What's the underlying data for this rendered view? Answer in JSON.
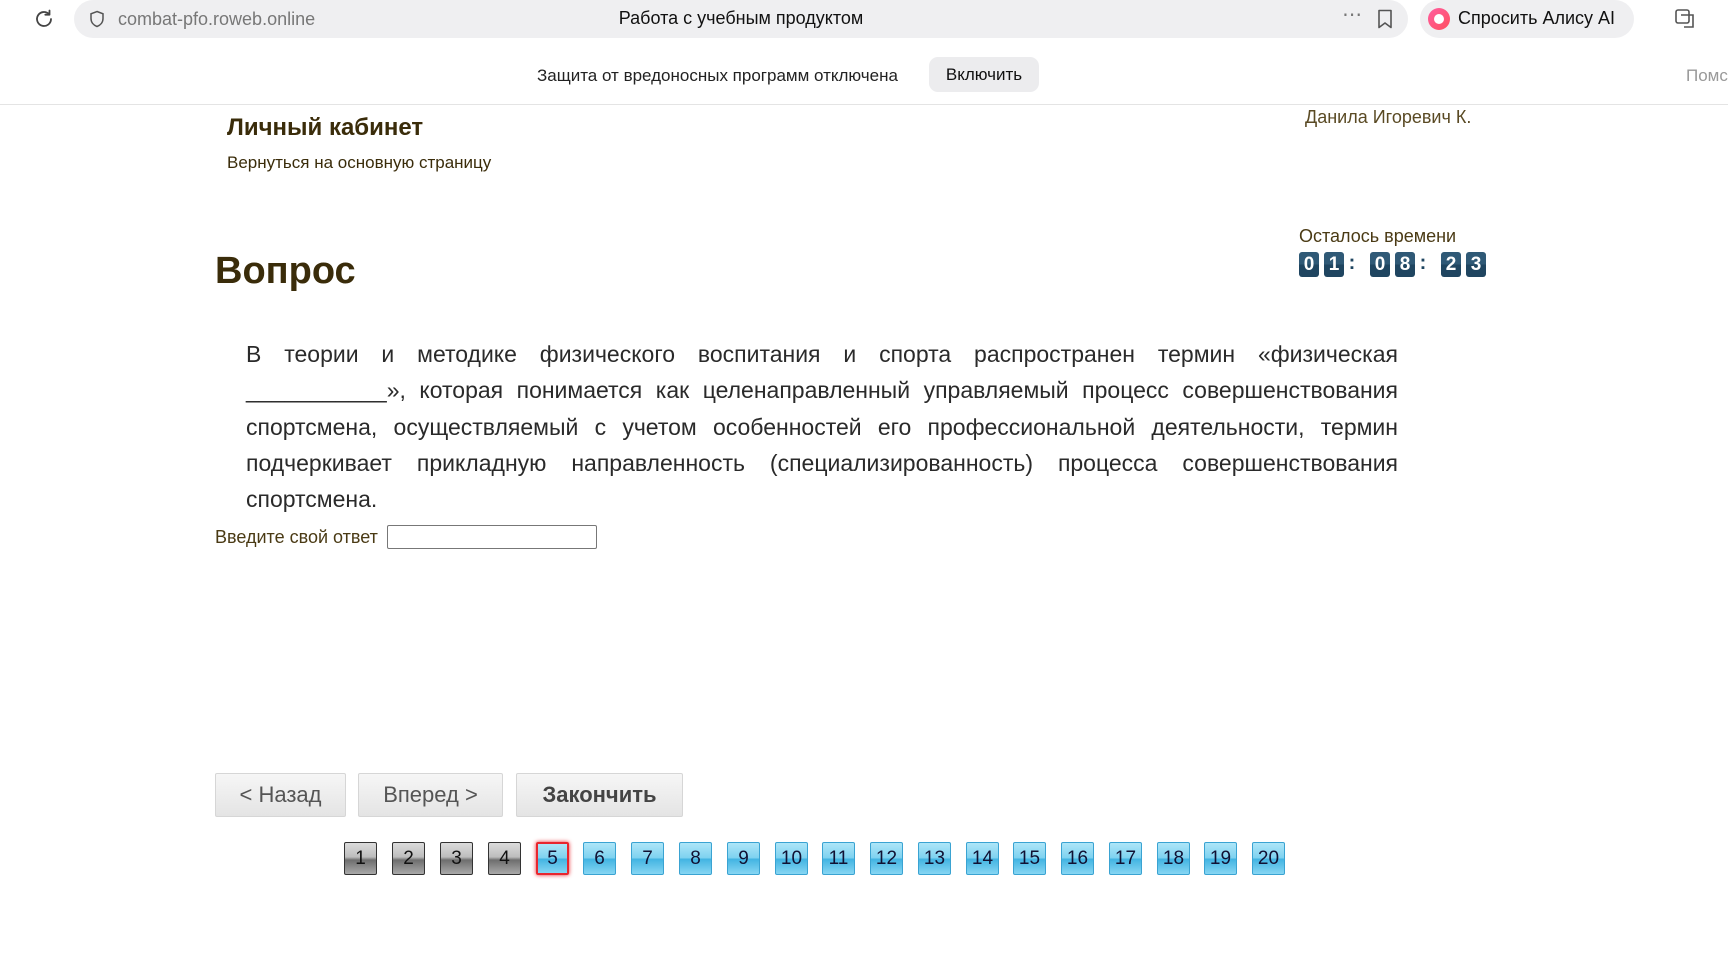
{
  "browser": {
    "url": "combat-pfo.roweb.online",
    "page_title": "Работа с учебным продуктом",
    "alice_label": "Спросить Алису AI"
  },
  "protection_bar": {
    "text": "Защита от вредоносных программ отключена",
    "button_label": "Включить",
    "help_label": "Помс"
  },
  "header": {
    "cabinet_title": "Личный кабинет",
    "back_link": "Вернуться на основную страницу",
    "user_name": "Данила Игоревич К."
  },
  "timer": {
    "label": "Осталось времени",
    "digits": [
      "0",
      "1",
      "0",
      "8",
      "2",
      "3"
    ],
    "separator": ":"
  },
  "question": {
    "title": "Вопрос",
    "text": "В теории и методике физического воспитания и спорта распространен термин «физическая ___________», которая понимается как целенаправленный управляемый процесс совершенствования спортсмена, осуществляемый с учетом особенностей его профессиональной деятельности, термин подчеркивает прикладную направленность (специализированность) процесса совершенствования спортсмена.",
    "answer_label": "Введите свой ответ",
    "answer_value": ""
  },
  "navigation": {
    "back_label": "< Назад",
    "forward_label": "Вперед >",
    "finish_label": "Закончить"
  },
  "question_numbers": [
    "1",
    "2",
    "3",
    "4",
    "5",
    "6",
    "7",
    "8",
    "9",
    "10",
    "11",
    "12",
    "13",
    "14",
    "15",
    "16",
    "17",
    "18",
    "19",
    "20"
  ],
  "answered_count": 4,
  "current_question": 5,
  "colors": {
    "heading": "#3a2c0a",
    "timer_digit": "#1f4560",
    "pager_pending": "#42b4e2",
    "pager_answered": "#6e6e6e",
    "pager_current_border": "#e8262e"
  }
}
